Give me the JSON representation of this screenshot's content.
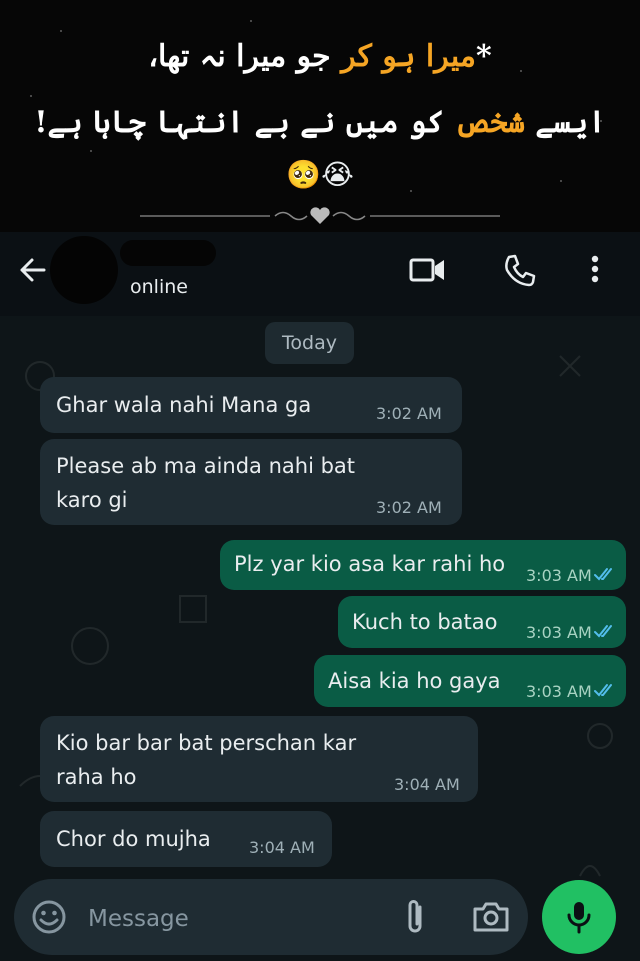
{
  "banner": {
    "line1_pre": "*",
    "line1_hl": "میرا ہو کر",
    "line1_post": " جو میرا نہ تھا،",
    "line2_pre": "ایسے ",
    "line2_hl": "شخص",
    "line2_post": " کو میں نے بے انتہا چاہا ہے!",
    "emojis": "🥺😭",
    "highlight_color": "#f5a524"
  },
  "header": {
    "status": "online",
    "icons": [
      "back-arrow-icon",
      "video-call-icon",
      "voice-call-icon",
      "more-options-icon"
    ]
  },
  "chat": {
    "date_label": "Today",
    "messages": [
      {
        "dir": "in",
        "text": "Ghar wala nahi Mana ga",
        "time": "3:02 AM"
      },
      {
        "dir": "in",
        "text": "Please ab ma ainda nahi bat karo gi",
        "time": "3:02 AM"
      },
      {
        "dir": "out",
        "text": "Plz yar kio asa kar rahi ho",
        "time": "3:03 AM",
        "status": "read"
      },
      {
        "dir": "out",
        "text": "Kuch to batao",
        "time": "3:03 AM",
        "status": "read"
      },
      {
        "dir": "out",
        "text": "Aisa kia ho gaya",
        "time": "3:03 AM",
        "status": "read"
      },
      {
        "dir": "in",
        "text": "Kio bar bar bat perschan kar raha ho",
        "time": "3:04 AM"
      },
      {
        "dir": "in",
        "text": "Chor do mujha",
        "time": "3:04 AM"
      }
    ]
  },
  "composer": {
    "placeholder": "Message",
    "icons": [
      "emoji-icon",
      "attach-icon",
      "camera-icon",
      "mic-icon"
    ],
    "mic_color": "#21c063"
  },
  "colors": {
    "incoming_bubble": "#1f2c33",
    "outgoing_bubble": "#0a5c45",
    "read_ticks": "#53bdeb"
  }
}
